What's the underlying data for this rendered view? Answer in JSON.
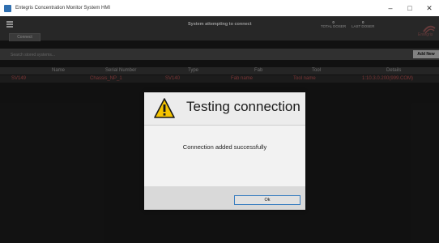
{
  "window": {
    "title": "Entegris Concentration Monitor System HMI",
    "controls": {
      "minimize": "–",
      "maximize": "□",
      "close": "✕"
    }
  },
  "header": {
    "tab_label": "Connect",
    "status_text": "System attempting to connect",
    "stats": [
      {
        "value": "0",
        "label": "TOTAL DOSER"
      },
      {
        "value": "0",
        "label": "LAST DOSER"
      }
    ],
    "brand": "Entegris"
  },
  "search": {
    "placeholder": "Search stored systems...",
    "add_button": "Add New"
  },
  "table": {
    "columns": [
      "Name",
      "Serial Number",
      "Type",
      "Fab",
      "Tool",
      "Details"
    ],
    "rows": [
      [
        "SV149",
        "Chassis_NP_1",
        "SV140",
        "Fab name",
        "Tool name",
        "1:10.3.0.200(999.COM)"
      ]
    ]
  },
  "dialog": {
    "title": "Testing connection",
    "message": "Connection added successfully",
    "ok_button": "Ok",
    "icon": "warning-icon"
  },
  "colors": {
    "accent": "#3c7fc0",
    "row_text": "#bb5050",
    "warning": "#f5c400"
  }
}
